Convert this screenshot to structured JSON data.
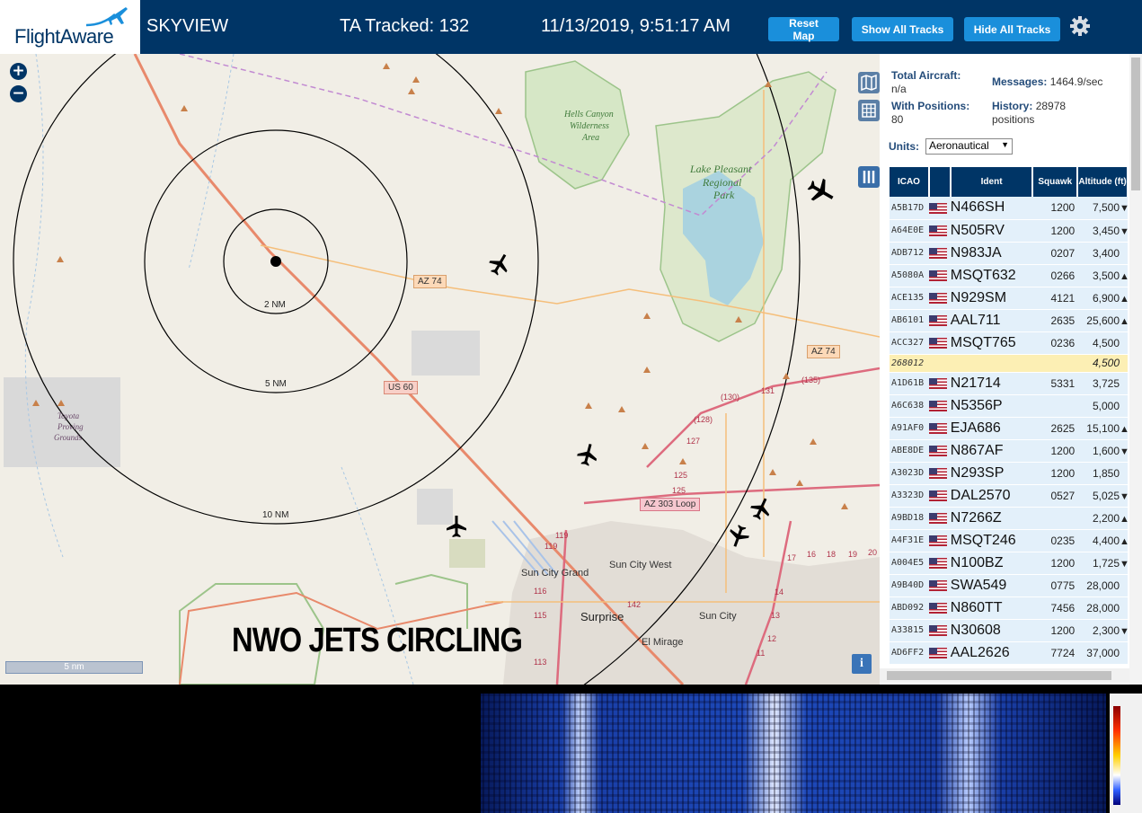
{
  "header": {
    "logo_text": "FlightAware",
    "title": "SKYVIEW",
    "tracked": "TA Tracked: 132",
    "datetime": "11/13/2019, 9:51:17 AM",
    "buttons": {
      "reset": "Reset Map",
      "show": "Show All Tracks",
      "hide": "Hide All Tracks"
    }
  },
  "map": {
    "zoom_in": "+",
    "zoom_out": "−",
    "ring_labels": [
      "2 NM",
      "5 NM",
      "10 NM"
    ],
    "place_labels": [
      "Hells Canyon",
      "Wilderness",
      "Area",
      "Lake Pleasant",
      "Regional",
      "Park",
      "Toyota",
      "Proving",
      "Grounds",
      "Sun City Grand",
      "Sun City West",
      "Surprise",
      "Sun City",
      "El Mirage"
    ],
    "road_labels": [
      "AZ 74",
      "AZ 74",
      "US 60",
      "AZ 303 Loop"
    ],
    "route_numbers": [
      "(130)",
      "131",
      "(135)",
      "(128)",
      "127",
      "125",
      "125",
      "119",
      "119",
      "116",
      "115",
      "113",
      "142",
      "17",
      "16",
      "18",
      "19",
      "20",
      "14",
      "13",
      "12",
      "11"
    ],
    "scale": "5 nm",
    "overlay_text": "NWO JETS CIRCLING",
    "info": "i"
  },
  "panel": {
    "total_aircraft_label": "Total Aircraft:",
    "total_aircraft_value": "n/a",
    "messages_label": "Messages:",
    "messages_value": "1464.9/sec",
    "with_positions_label": "With Positions:",
    "with_positions_value": "80",
    "history_label": "History:",
    "history_value": "28978",
    "history_unit": "positions",
    "units_label": "Units:",
    "units_value": "Aeronautical",
    "columns": [
      "ICAO",
      "Ident",
      "Squawk",
      "Altitude (ft)"
    ],
    "rows": [
      {
        "icao": "A5B17D",
        "ident": "N466SH",
        "squawk": "1200",
        "alt": "7,500",
        "trend": "▼"
      },
      {
        "icao": "A64E0E",
        "ident": "N505RV",
        "squawk": "1200",
        "alt": "3,450",
        "trend": "▼"
      },
      {
        "icao": "ADB712",
        "ident": "N983JA",
        "squawk": "0207",
        "alt": "3,400",
        "trend": ""
      },
      {
        "icao": "A5080A",
        "ident": "MSQT632",
        "squawk": "0266",
        "alt": "3,500",
        "trend": "▲"
      },
      {
        "icao": "ACE135",
        "ident": "N929SM",
        "squawk": "4121",
        "alt": "6,900",
        "trend": "▲"
      },
      {
        "icao": "AB6101",
        "ident": "AAL711",
        "squawk": "2635",
        "alt": "25,600",
        "trend": "▲"
      },
      {
        "icao": "ACC327",
        "ident": "MSQT765",
        "squawk": "0236",
        "alt": "4,500",
        "trend": ""
      },
      {
        "icao": "268012",
        "ident": "",
        "squawk": "",
        "alt": "4,500",
        "trend": "",
        "highlight": true
      },
      {
        "icao": "A1D61B",
        "ident": "N21714",
        "squawk": "5331",
        "alt": "3,725",
        "trend": ""
      },
      {
        "icao": "A6C638",
        "ident": "N5356P",
        "squawk": "",
        "alt": "5,000",
        "trend": ""
      },
      {
        "icao": "A91AF0",
        "ident": "EJA686",
        "squawk": "2625",
        "alt": "15,100",
        "trend": "▲"
      },
      {
        "icao": "ABE8DE",
        "ident": "N867AF",
        "squawk": "1200",
        "alt": "1,600",
        "trend": "▼"
      },
      {
        "icao": "A3023D",
        "ident": "N293SP",
        "squawk": "1200",
        "alt": "1,850",
        "trend": ""
      },
      {
        "icao": "A3323D",
        "ident": "DAL2570",
        "squawk": "0527",
        "alt": "5,025",
        "trend": "▼"
      },
      {
        "icao": "A9BD18",
        "ident": "N7266Z",
        "squawk": "",
        "alt": "2,200",
        "trend": "▲"
      },
      {
        "icao": "A4F31E",
        "ident": "MSQT246",
        "squawk": "0235",
        "alt": "4,400",
        "trend": "▲"
      },
      {
        "icao": "A004E5",
        "ident": "N100BZ",
        "squawk": "1200",
        "alt": "1,725",
        "trend": "▼"
      },
      {
        "icao": "A9B40D",
        "ident": "SWA549",
        "squawk": "0775",
        "alt": "28,000",
        "trend": ""
      },
      {
        "icao": "ABD092",
        "ident": "N860TT",
        "squawk": "7456",
        "alt": "28,000",
        "trend": ""
      },
      {
        "icao": "A33815",
        "ident": "N30608",
        "squawk": "1200",
        "alt": "2,300",
        "trend": "▼"
      },
      {
        "icao": "AD6FF2",
        "ident": "AAL2626",
        "squawk": "7724",
        "alt": "37,000",
        "trend": ""
      }
    ]
  },
  "colors": {
    "header_bg": "#003566",
    "button_bg": "#1a8fdb",
    "map_bg": "#f1eee6",
    "table_header": "#003566",
    "row_bg": "#e3f0fa",
    "row_highlight": "#fcefb4"
  },
  "icons": [
    "plane-logo-icon",
    "gear-icon",
    "zoom-in-icon",
    "zoom-out-icon",
    "map-layer-icon",
    "grid-icon",
    "columns-icon",
    "info-icon",
    "aircraft-icon",
    "flag-us-icon",
    "chevron-down-icon"
  ]
}
